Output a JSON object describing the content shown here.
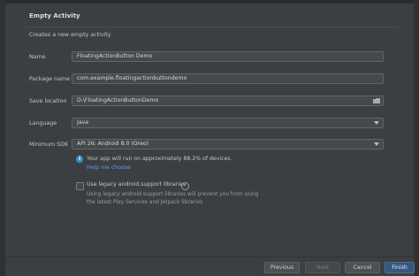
{
  "header": {
    "title": "Empty Activity",
    "subtitle": "Creates a new empty activity"
  },
  "form": {
    "name": {
      "label": "Name",
      "value": "FloatingActionButton Demo"
    },
    "package": {
      "label": "Package name",
      "value": "com.example.floatingactionbuttondemo"
    },
    "save_location": {
      "label": "Save location",
      "value": "D:\\FloatingActionButtonDemo",
      "icon": "folder-icon"
    },
    "language": {
      "label": "Language",
      "value": "Java"
    },
    "min_sdk": {
      "label": "Minimum SDK",
      "value": "API 26: Android 8.0 (Oreo)"
    }
  },
  "info": {
    "text": "Your app will run on approximately 88.2% of devices.",
    "help_link": "Help me choose",
    "icon": "info-icon"
  },
  "legacy": {
    "checkbox_label": "Use legacy android.support libraries",
    "note_line1": "Using legacy android.support libraries will prevent you from using",
    "note_line2": "the latest Play Services and Jetpack libraries",
    "checked": false
  },
  "buttons": {
    "previous": "Previous",
    "next": "Next",
    "cancel": "Cancel",
    "finish": "Finish"
  },
  "colors": {
    "background": "#3c3f41",
    "field_bg": "#45494a",
    "accent": "#365880",
    "link": "#589df6",
    "info": "#3592c4"
  }
}
